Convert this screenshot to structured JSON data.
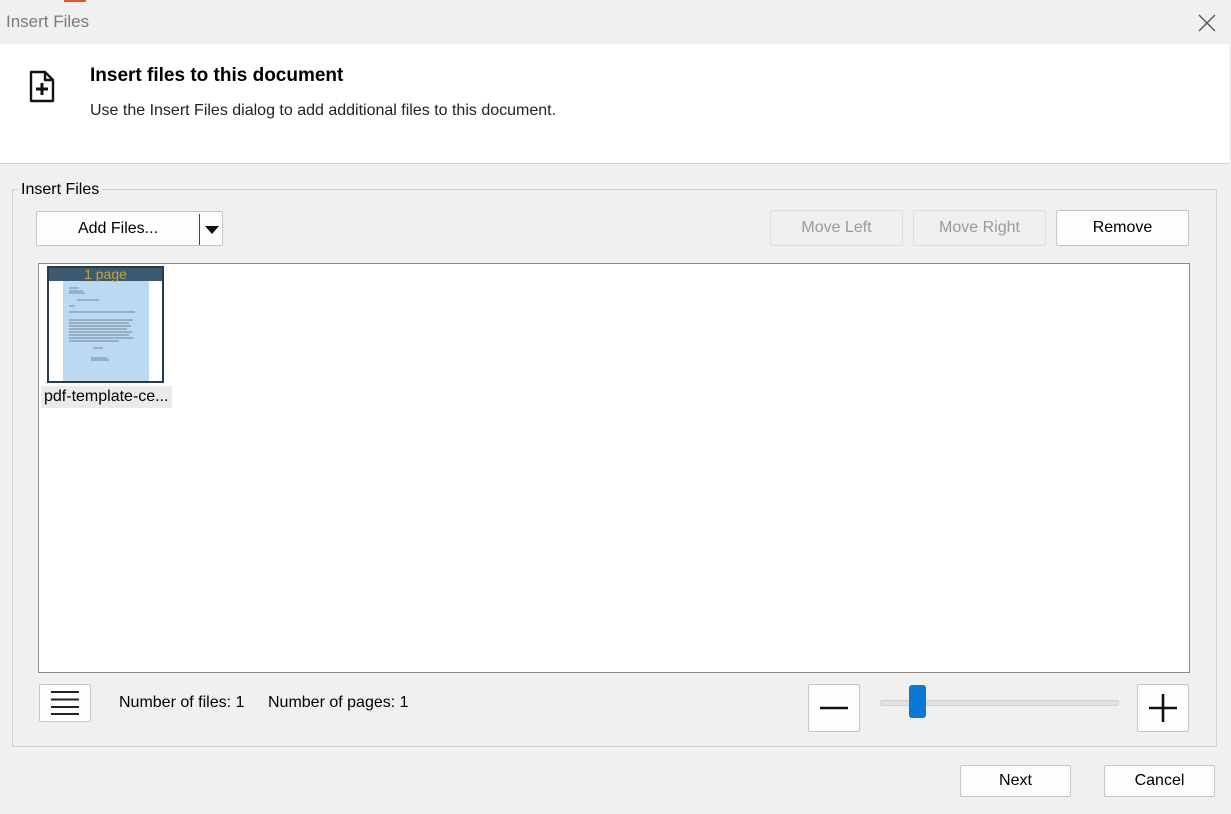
{
  "window": {
    "title": "Insert Files",
    "close_icon": "close-icon",
    "accent_color": "#e0592a"
  },
  "header": {
    "icon": "document-add-icon",
    "heading": "Insert files to this document",
    "description": "Use the Insert Files dialog to add additional files to this document."
  },
  "group": {
    "label": "Insert Files"
  },
  "toolbar": {
    "add_files_label": "Add Files...",
    "add_files_dropdown_icon": "chevron-down-icon",
    "move_left_label": "Move Left",
    "move_right_label": "Move Right",
    "remove_label": "Remove"
  },
  "files": [
    {
      "name": "pdf-template-ce...",
      "badge": "1 page",
      "selected": true
    }
  ],
  "footer": {
    "list_view_icon": "hamburger-menu-icon",
    "number_of_files": "Number of files: 1",
    "number_of_pages": "Number of pages: 1",
    "zoom_out_icon": "minus-icon",
    "zoom_in_icon": "plus-icon",
    "zoom_level_fraction": 0.13,
    "slider_color": "#0a78d7"
  },
  "actions": {
    "next_label": "Next",
    "cancel_label": "Cancel"
  },
  "colors": {
    "thumbnail_selection": "#bcd9f2",
    "badge_background": "#3d5a72",
    "badge_text": "#c9a33a"
  }
}
